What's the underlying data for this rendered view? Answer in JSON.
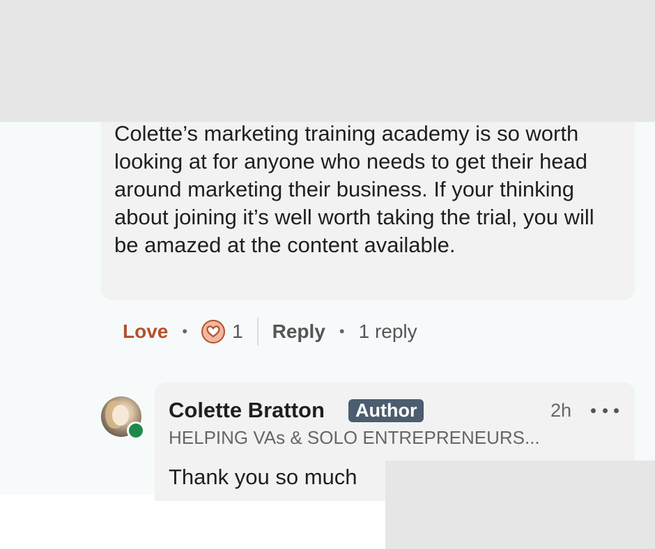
{
  "comment": {
    "text": "Colette’s marketing training academy is so worth looking at for anyone who needs to get their head around marketing their business. If your thinking about joining it’s well worth taking the trial, you will be amazed at the content available."
  },
  "actions": {
    "love_label": "Love",
    "separator": "•",
    "reaction_icon": "heart-icon",
    "reaction_count": "1",
    "reply_label": "Reply",
    "reply_count_label": "1 reply"
  },
  "reply": {
    "author": "Colette Bratton",
    "badge": "Author",
    "time": "2h",
    "headline": "HELPING VAs & SOLO ENTREPRENEURS...",
    "text": "Thank you so much",
    "online": true
  },
  "colors": {
    "love": "#b5502b",
    "badge_bg": "#4b5d6f",
    "online": "#1d8a4c",
    "bubble": "#f2f2f2",
    "redaction": "#e6e6e6"
  }
}
